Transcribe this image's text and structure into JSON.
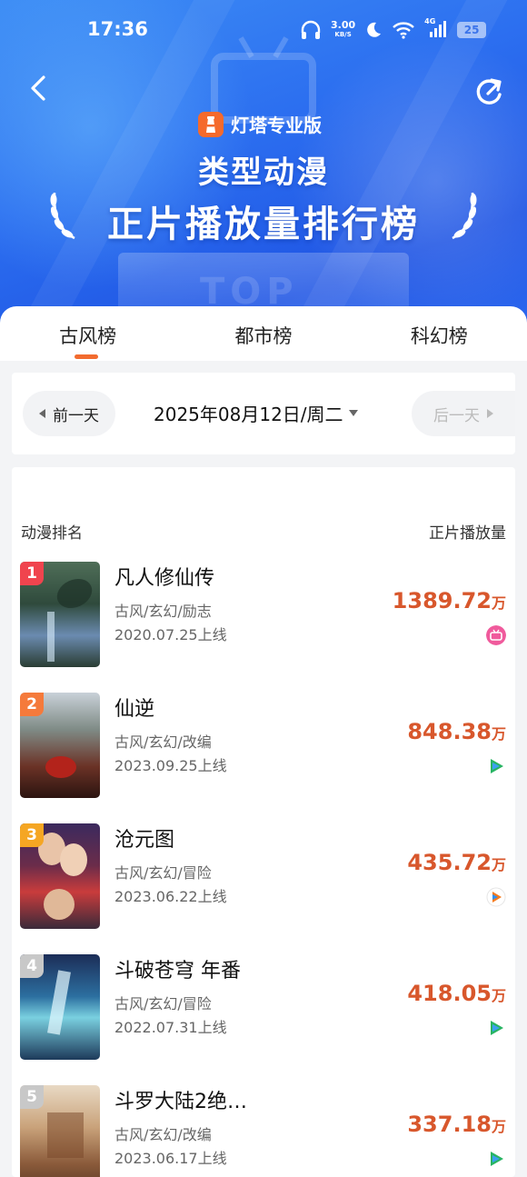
{
  "status_bar": {
    "time": "17:36",
    "net_speed": "3.00",
    "net_unit": "KB/S",
    "network": "4G",
    "battery": "25"
  },
  "header": {
    "brand": "灯塔专业版",
    "title_line1": "类型动漫",
    "title_line2": "正片播放量排行榜",
    "bg_word": "TOP"
  },
  "tabs": [
    {
      "label": "古风榜",
      "active": true
    },
    {
      "label": "都市榜",
      "active": false
    },
    {
      "label": "科幻榜",
      "active": false
    }
  ],
  "date_bar": {
    "prev_label": "前一天",
    "date": "2025年08月12日/周二",
    "next_label": "后一天"
  },
  "list": {
    "col_name": "动漫排名",
    "col_value": "正片播放量",
    "unit": "万",
    "items": [
      {
        "rank": "1",
        "name": "凡人修仙传",
        "tags": "古风/玄幻/励志",
        "release": "2020.07.25上线",
        "plays": "1389.72",
        "platform": "bilibili-icon",
        "rank_color": "#f0444e"
      },
      {
        "rank": "2",
        "name": "仙逆",
        "tags": "古风/玄幻/改编",
        "release": "2023.09.25上线",
        "plays": "848.38",
        "platform": "tencent-video-icon",
        "rank_color": "#f57a3b"
      },
      {
        "rank": "3",
        "name": "沧元图",
        "tags": "古风/玄幻/冒险",
        "release": "2023.06.22上线",
        "plays": "435.72",
        "platform": "tencent-video-icon",
        "rank_color": "#f5a623"
      },
      {
        "rank": "4",
        "name": "斗破苍穹 年番",
        "tags": "古风/玄幻/冒险",
        "release": "2022.07.31上线",
        "plays": "418.05",
        "platform": "tencent-video-icon",
        "rank_color": "#c8c8c8"
      },
      {
        "rank": "5",
        "name": "斗罗大陆2绝…",
        "tags": "古风/玄幻/改编",
        "release": "2023.06.17上线",
        "plays": "337.18",
        "platform": "tencent-video-icon",
        "rank_color": "#c8c8c8"
      }
    ]
  },
  "colors": {
    "accent": "#f26b2f",
    "value": "#d8572c",
    "header_blue": "#2c6ff0"
  }
}
